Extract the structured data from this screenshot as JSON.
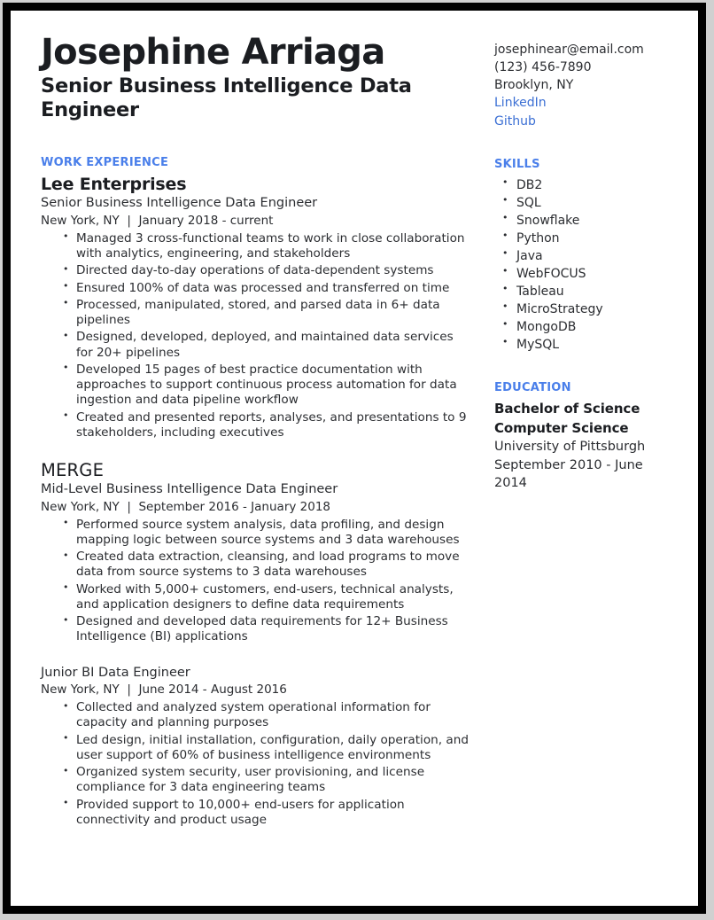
{
  "theme": {
    "accent": "#4a7fea",
    "link": "#3b6fd4",
    "text": "#2b2d31",
    "heading": "#1b1d21",
    "page_background": "#ffffff",
    "frame": "#000000"
  },
  "header": {
    "name": "Josephine Arriaga",
    "headline": "Senior Business Intelligence Data Engineer"
  },
  "contact": {
    "email": "josephinear@email.com",
    "phone": "(123) 456-7890",
    "location": "Brooklyn, NY",
    "linkedin_label": "LinkedIn",
    "github_label": "Github"
  },
  "work_experience": {
    "heading": "WORK EXPERIENCE",
    "jobs": [
      {
        "company": "Lee Enterprises",
        "company_style": "bold",
        "title": "Senior Business Intelligence Data Engineer",
        "meta": "New York, NY  |  January 2018 - current",
        "bullets": [
          "Managed 3 cross-functional teams to work in close collaboration with analytics, engineering, and stakeholders",
          "Directed day-to-day operations of data-dependent systems",
          "Ensured 100% of data was processed and transferred on time",
          "Processed, manipulated, stored, and parsed data in 6+ data pipelines",
          "Designed, developed, deployed, and maintained data services for 20+ pipelines",
          "Developed 15 pages of best practice documentation with approaches to support continuous process automation for data ingestion and data pipeline workflow",
          "Created and presented reports, analyses, and presentations to 9 stakeholders, including executives"
        ]
      },
      {
        "company": "MERGE",
        "company_style": "light",
        "title": "Mid-Level Business Intelligence Data Engineer",
        "meta": "New York, NY  |  September 2016 - January 2018",
        "bullets": [
          "Performed source system analysis, data profiling, and design mapping logic between source systems and 3 data warehouses",
          "Created data extraction, cleansing, and load programs to move data from source systems to 3 data warehouses",
          "Worked with 5,000+ customers, end-users, technical analysts, and application designers to define data requirements",
          "Designed and developed data requirements for 12+ Business Intelligence (BI) applications"
        ]
      },
      {
        "company": "",
        "company_style": "none",
        "title": "Junior BI Data Engineer",
        "meta": "New York, NY  |  June 2014 - August 2016",
        "bullets": [
          "Collected and analyzed system operational information for capacity and planning purposes",
          "Led design, initial installation, configuration, daily operation, and user support of 60% of business intelligence environments",
          "Organized system security, user provisioning, and license compliance for 3 data engineering teams",
          "Provided support to 10,000+ end-users for application connectivity and product usage"
        ]
      }
    ]
  },
  "skills": {
    "heading": "SKILLS",
    "items": [
      "DB2",
      "SQL",
      "Snowflake",
      "Python",
      "Java",
      "WebFOCUS",
      "Tableau",
      "MicroStrategy",
      "MongoDB",
      "MySQL"
    ]
  },
  "education": {
    "heading": "EDUCATION",
    "degree": "Bachelor of Science",
    "major": "Computer Science",
    "school": "University of Pittsburgh",
    "dates": "September 2010 - June 2014"
  }
}
